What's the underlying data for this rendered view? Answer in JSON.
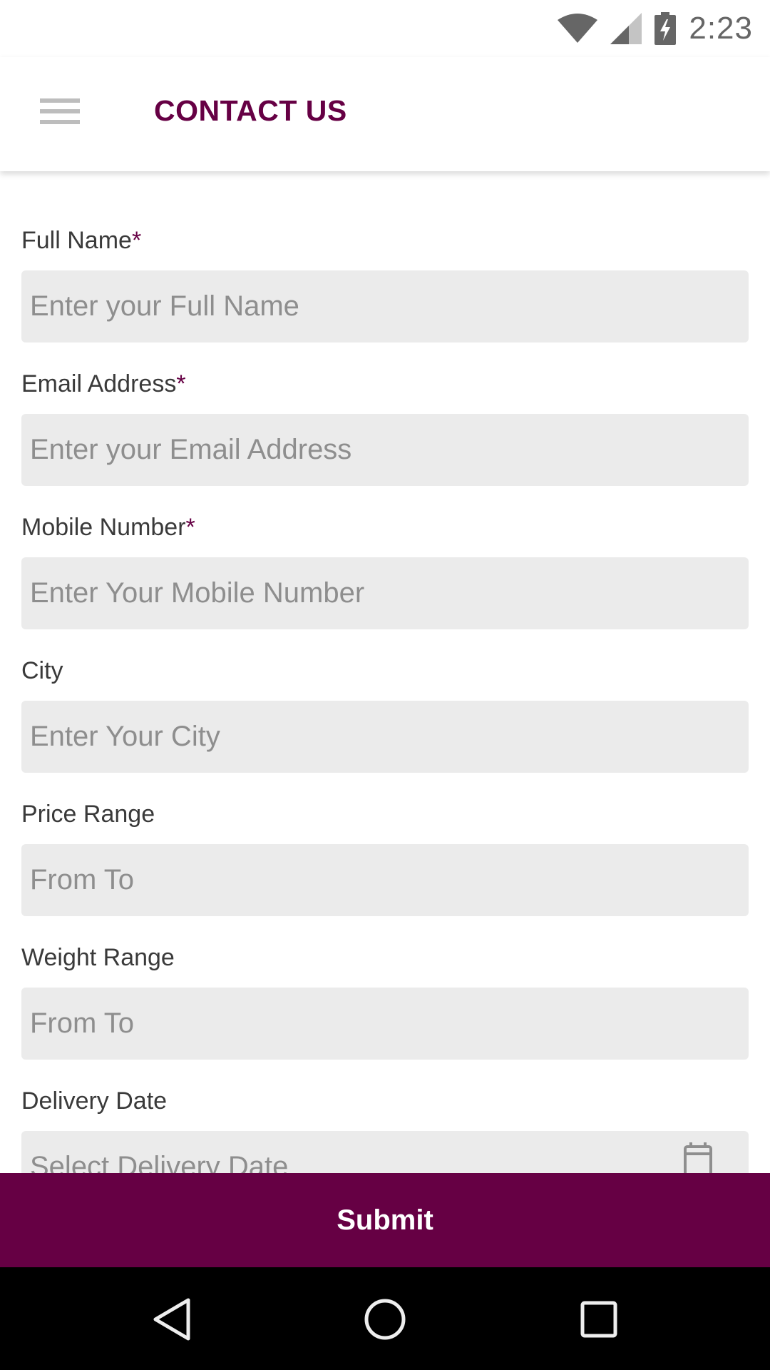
{
  "status_bar": {
    "time": "2:23",
    "icons": [
      "wifi-icon",
      "cell-signal-icon",
      "battery-charging-icon"
    ]
  },
  "app_bar": {
    "menu_icon": "hamburger-menu-icon",
    "title": "CONTACT US"
  },
  "colors": {
    "brand": "#660044",
    "input_bg": "#ebebeb",
    "placeholder": "#8e8e8e",
    "label": "#3a3a3a"
  },
  "form": {
    "fields": [
      {
        "label": "Full Name",
        "required": "*",
        "placeholder": "Enter your Full Name",
        "value": ""
      },
      {
        "label": "Email Address",
        "required": "*",
        "placeholder": "Enter your Email Address",
        "value": ""
      },
      {
        "label": "Mobile Number",
        "required": "*",
        "placeholder": "Enter Your Mobile Number",
        "value": ""
      },
      {
        "label": "City",
        "required": "",
        "placeholder": "Enter Your City",
        "value": ""
      },
      {
        "label": "Price Range",
        "required": "",
        "placeholder": "From To",
        "value": ""
      },
      {
        "label": "Weight Range",
        "required": "",
        "placeholder": "From To",
        "value": ""
      },
      {
        "label": "Delivery Date",
        "required": "",
        "placeholder": "Select Delivery Date",
        "value": "",
        "icon": "calendar-icon"
      }
    ]
  },
  "submit": {
    "label": "Submit"
  },
  "nav_bar": {
    "buttons": [
      "back-icon",
      "home-icon",
      "recents-icon"
    ]
  }
}
